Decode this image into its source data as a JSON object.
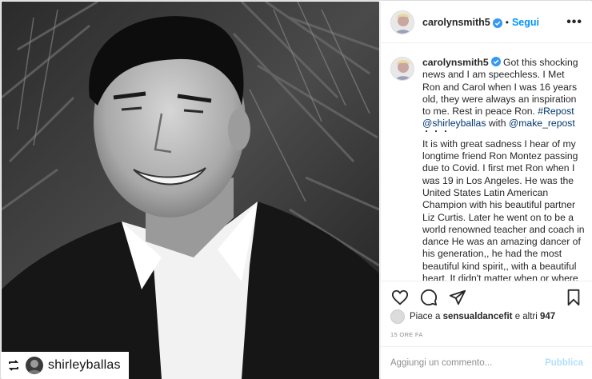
{
  "post": {
    "author": "carolynsmith5",
    "follow_separator": "•",
    "follow_label": "Segui",
    "more_label": "•••",
    "caption": {
      "username": "carolynsmith5",
      "text": "Got this shocking news and I am speechless. I Met Ron and Carol when I was 16 years old, they were always an inspiration to me. Rest in peace Ron.",
      "hashtag": "#Repost",
      "mention": "@shirleyballas",
      "with_text": "with",
      "repost_mention": "@make_repost",
      "dots": "・・・"
    },
    "body": "It is with great sadness I hear of my longtime friend Ron Montez passing due to Covid. I first met Ron when I was 19 in Los Angeles. He was the United States Latin American Champion with his beautiful partner Liz Curtis. Later he went on to be a world renowned teacher and coach in dance He was an amazing dancer of his generation,, he had the most beautiful kind spirit,, with a beautiful heart. It didn't matter when or where",
    "likes": {
      "prefix": "Piace a",
      "user": "sensualdancefit",
      "suffix": "e altri",
      "count": "947"
    },
    "timestamp": "15 ORE FA",
    "comment_placeholder": "Aggiungi un commento...",
    "publish_label": "Pubblica"
  },
  "photo": {
    "repost_handle": "shirleyballas",
    "repost_icon": "repost-icon"
  },
  "icons": {
    "like": "heart-icon",
    "comment": "comment-icon",
    "share": "paper-plane-icon",
    "save": "bookmark-icon",
    "verified": "verified-badge-icon"
  },
  "colors": {
    "link": "#00376b",
    "follow": "#0095f6",
    "verified": "#3897f0",
    "publish_disabled": "#b2dffc"
  }
}
